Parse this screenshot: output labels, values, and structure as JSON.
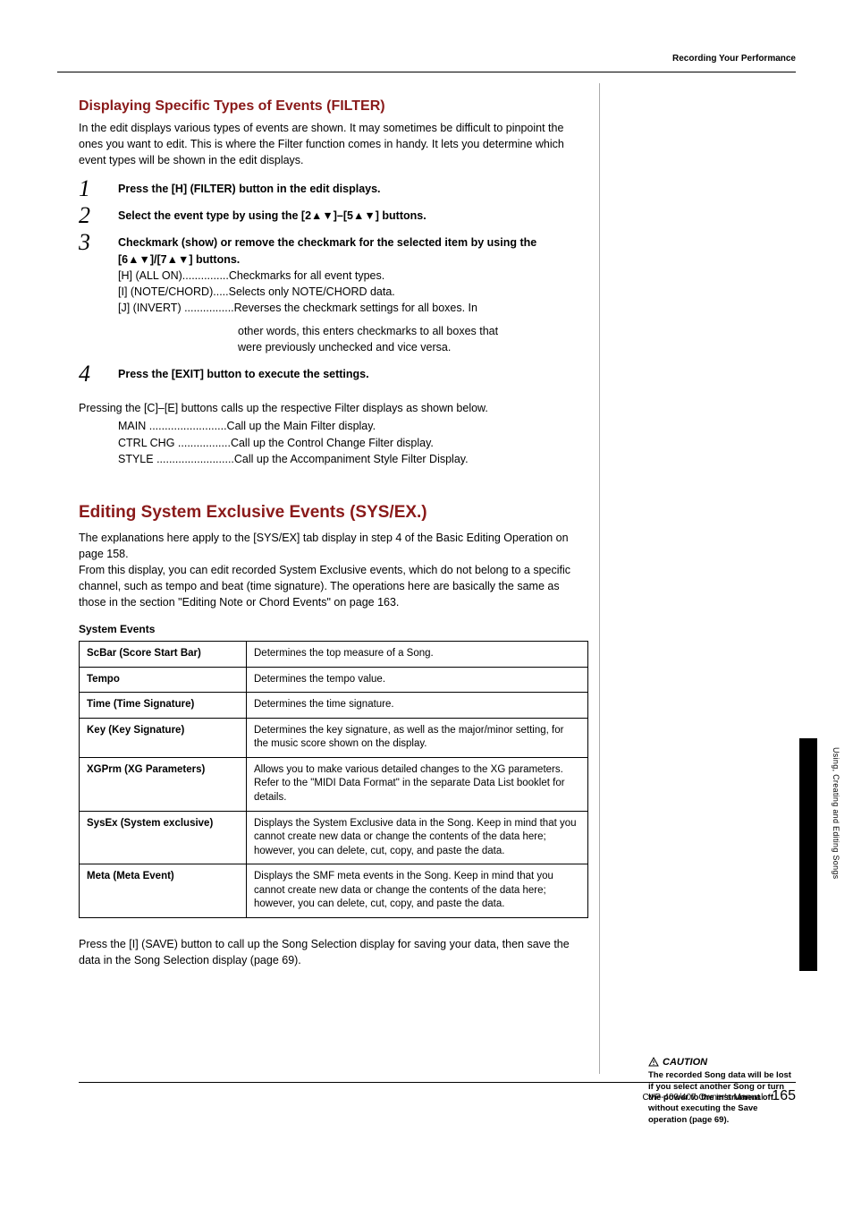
{
  "header": {
    "section": "Recording Your Performance"
  },
  "filter": {
    "title": "Displaying Specific Types of Events (FILTER)",
    "intro": "In the edit displays various types of events are shown. It may sometimes be difficult to pinpoint the ones you want to edit. This is where the Filter function comes in handy. It lets you determine which event types will be shown in the edit displays.",
    "step1": "Press the [H] (FILTER) button in the edit displays.",
    "step2": "Select the event type by using the [2▲▼]–[5▲▼] buttons.",
    "step3_bold": "Checkmark (show) or remove the checkmark for the selected item by using the [6▲▼]/[7▲▼] buttons.",
    "step3_h": "[H] (ALL ON)...............Checkmarks for all event types.",
    "step3_i": "[I] (NOTE/CHORD).....Selects only NOTE/CHORD data.",
    "step3_j": "[J] (INVERT) ................Reverses the checkmark settings for all boxes. In",
    "step3_j2": "other words, this enters checkmarks to all boxes that",
    "step3_j3": "were previously unchecked and vice versa.",
    "step4": "Press the [EXIT] button to execute the settings.",
    "post": "Pressing the [C]–[E] buttons calls up the respective Filter displays as shown below.",
    "post_main": "MAIN .........................Call up the Main Filter display.",
    "post_ctrl": "CTRL CHG .................Call up the Control Change Filter display.",
    "post_style": "STYLE .........................Call up the Accompaniment Style Filter Display."
  },
  "sysex": {
    "title": "Editing System Exclusive Events (SYS/EX.)",
    "intro1": "The explanations here apply to the [SYS/EX] tab display in step 4 of the Basic Editing Operation on page 158.",
    "intro2": "From this display, you can edit recorded System Exclusive events, which do not belong to a specific channel, such as tempo and beat (time signature). The operations here are basically the same as those in the section \"Editing Note or Chord Events\" on page 163.",
    "table_title": "System Events",
    "rows": [
      {
        "name": "ScBar (Score Start Bar)",
        "desc": "Determines the top measure of a Song."
      },
      {
        "name": "Tempo",
        "desc": "Determines the tempo value."
      },
      {
        "name": "Time (Time Signature)",
        "desc": "Determines the time signature."
      },
      {
        "name": "Key (Key Signature)",
        "desc": "Determines the key signature, as well as the major/minor setting, for the music score shown on the display."
      },
      {
        "name": "XGPrm (XG Parameters)",
        "desc": "Allows you to make various detailed changes to the XG parameters. Refer to the \"MIDI Data Format\" in the separate Data List booklet for details."
      },
      {
        "name": "SysEx (System exclusive)",
        "desc": "Displays the System Exclusive data in the Song. Keep in mind that you cannot create new data or change the contents of the data here; however, you can delete, cut, copy, and paste the data."
      },
      {
        "name": "Meta (Meta Event)",
        "desc": "Displays the SMF meta events in the Song. Keep in mind that you cannot create new data or change the contents of the data here; however, you can delete, cut, copy, and paste the data."
      }
    ],
    "after": "Press the [I] (SAVE) button to call up the Song Selection display for saving your data, then save the data in the Song Selection display (page 69)."
  },
  "sidebar": {
    "label": "Using, Creating and Editing Songs"
  },
  "caution": {
    "title": "CAUTION",
    "body": "The recorded Song data will be lost if you select another Song or turn the power to the instrument off without executing the Save operation (page 69)."
  },
  "footer": {
    "manual": "CVP-409/407 Owner's Manual",
    "page": "165"
  }
}
